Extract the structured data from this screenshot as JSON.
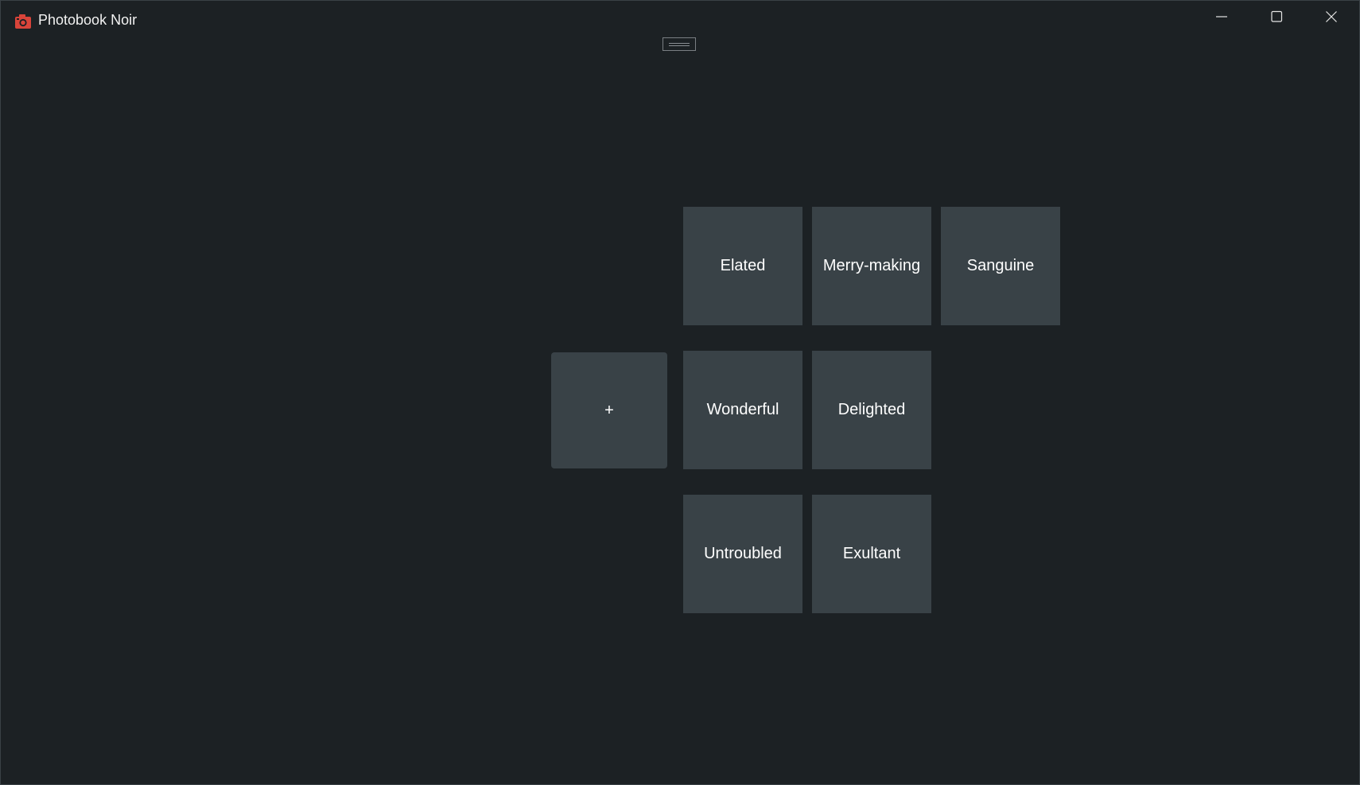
{
  "window": {
    "title": "Photobook Noir",
    "app_icon": "camera-icon",
    "controls": {
      "minimize_icon": "minimize-icon",
      "maximize_icon": "maximize-icon",
      "close_icon": "close-icon"
    }
  },
  "drag_handle_icon": "drag-handle-icon",
  "tiles": {
    "add_label": "+",
    "items": [
      "Elated",
      "Merry-making",
      "Sanguine",
      "Wonderful",
      "Delighted",
      "Untroubled",
      "Exultant"
    ]
  },
  "colors": {
    "background": "#1c2124",
    "tile": "#394247",
    "app_icon": "#d8443a"
  }
}
